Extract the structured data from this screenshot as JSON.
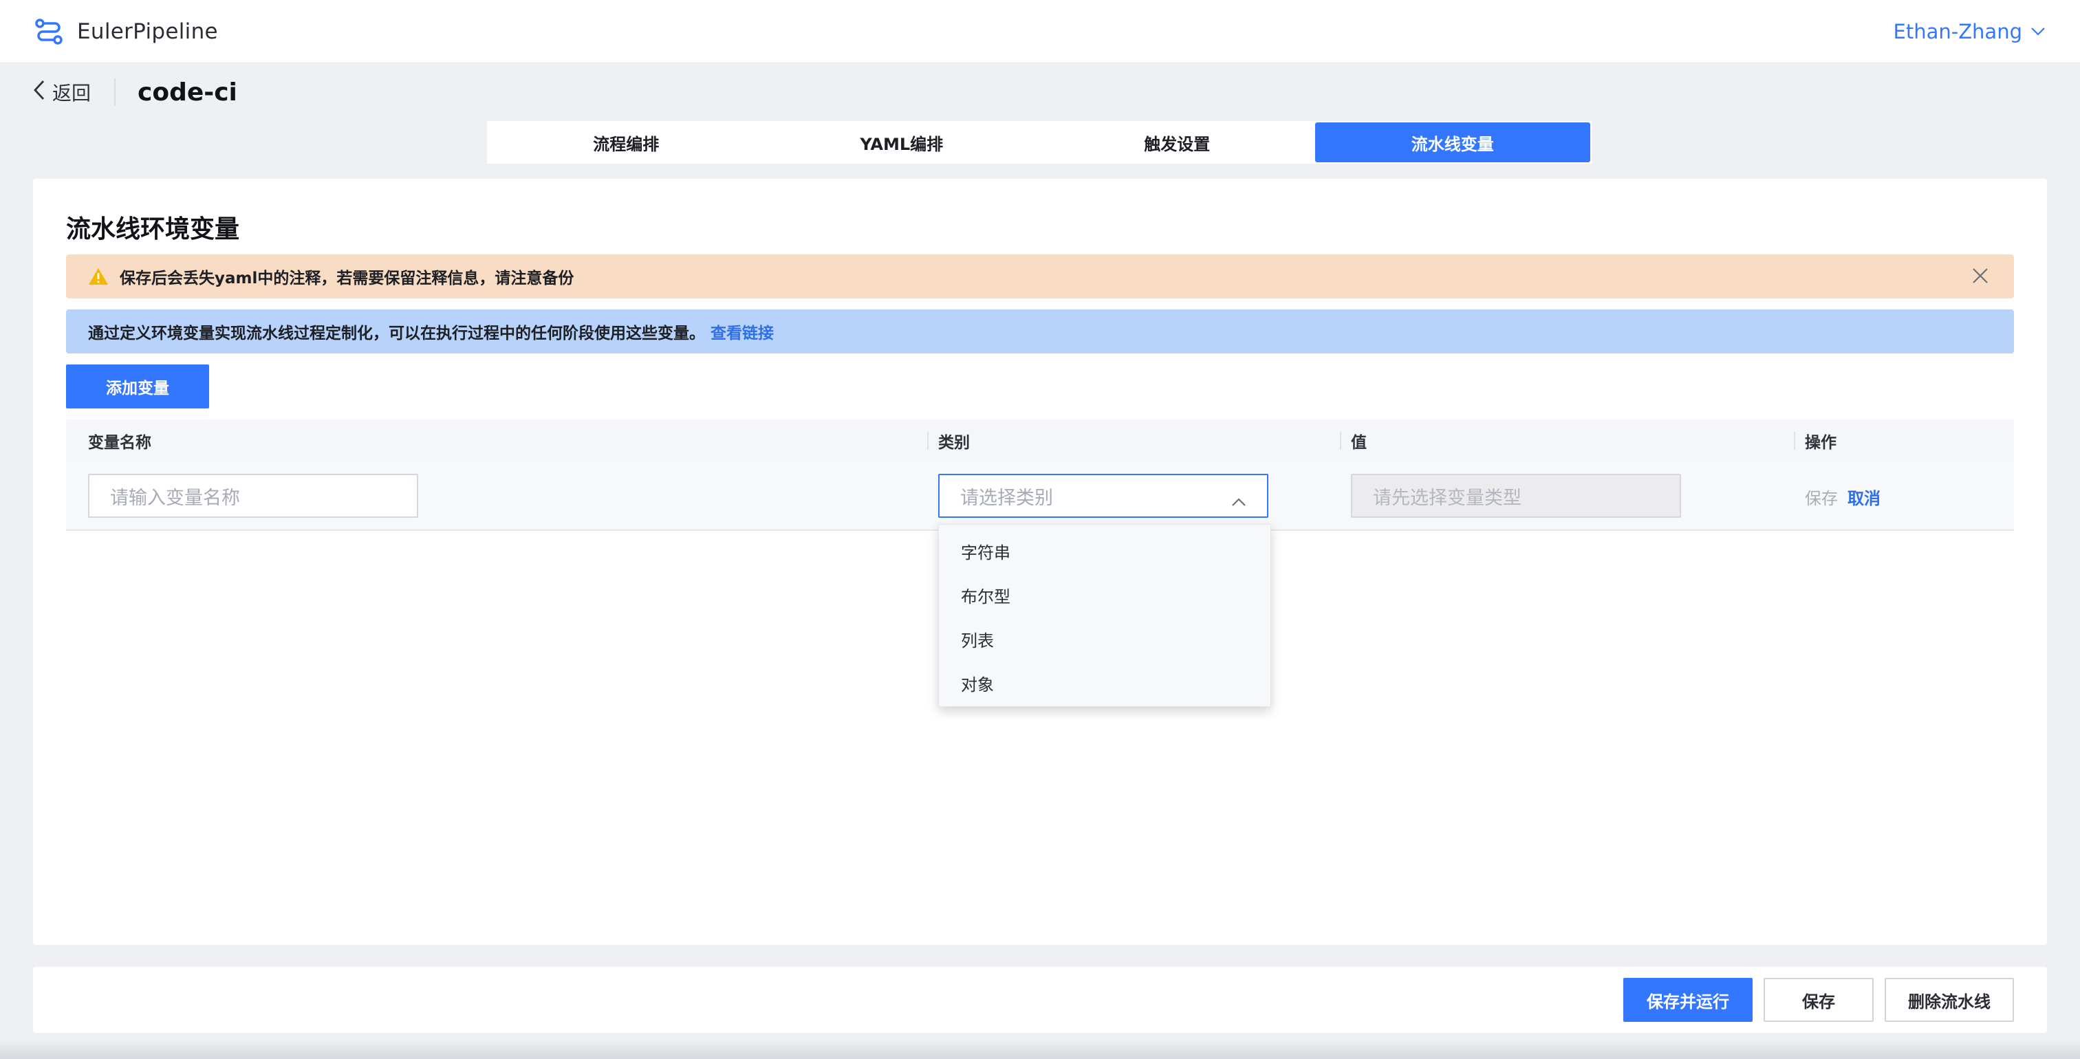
{
  "header": {
    "app_name": "EulerPipeline",
    "user_name": "Ethan-Zhang"
  },
  "breadcrumb": {
    "back_label": "返回",
    "pipeline_name": "code-ci"
  },
  "tabs": [
    {
      "label": "流程编排",
      "active": false
    },
    {
      "label": "YAML编排",
      "active": false
    },
    {
      "label": "触发设置",
      "active": false
    },
    {
      "label": "流水线变量",
      "active": true
    }
  ],
  "section": {
    "title": "流水线环境变量",
    "warning_text": "保存后会丢失yaml中的注释，若需要保留注释信息，请注意备份",
    "info_text": "通过定义环境变量实现流水线过程定制化，可以在执行过程中的任何阶段使用这些变量。",
    "info_link": "查看链接",
    "add_button": "添加变量"
  },
  "table": {
    "columns": [
      "变量名称",
      "类别",
      "值",
      "操作"
    ],
    "row": {
      "name_placeholder": "请输入变量名称",
      "type_placeholder": "请选择类别",
      "value_placeholder": "请先选择变量类型",
      "save_label": "保存",
      "cancel_label": "取消"
    },
    "type_options": [
      "字符串",
      "布尔型",
      "列表",
      "对象"
    ]
  },
  "footer": {
    "save_run": "保存并运行",
    "save": "保存",
    "delete": "删除流水线"
  },
  "colors": {
    "primary": "#3377ff",
    "warning_bg": "#f8dcc4",
    "info_bg": "#b8d3fb"
  }
}
